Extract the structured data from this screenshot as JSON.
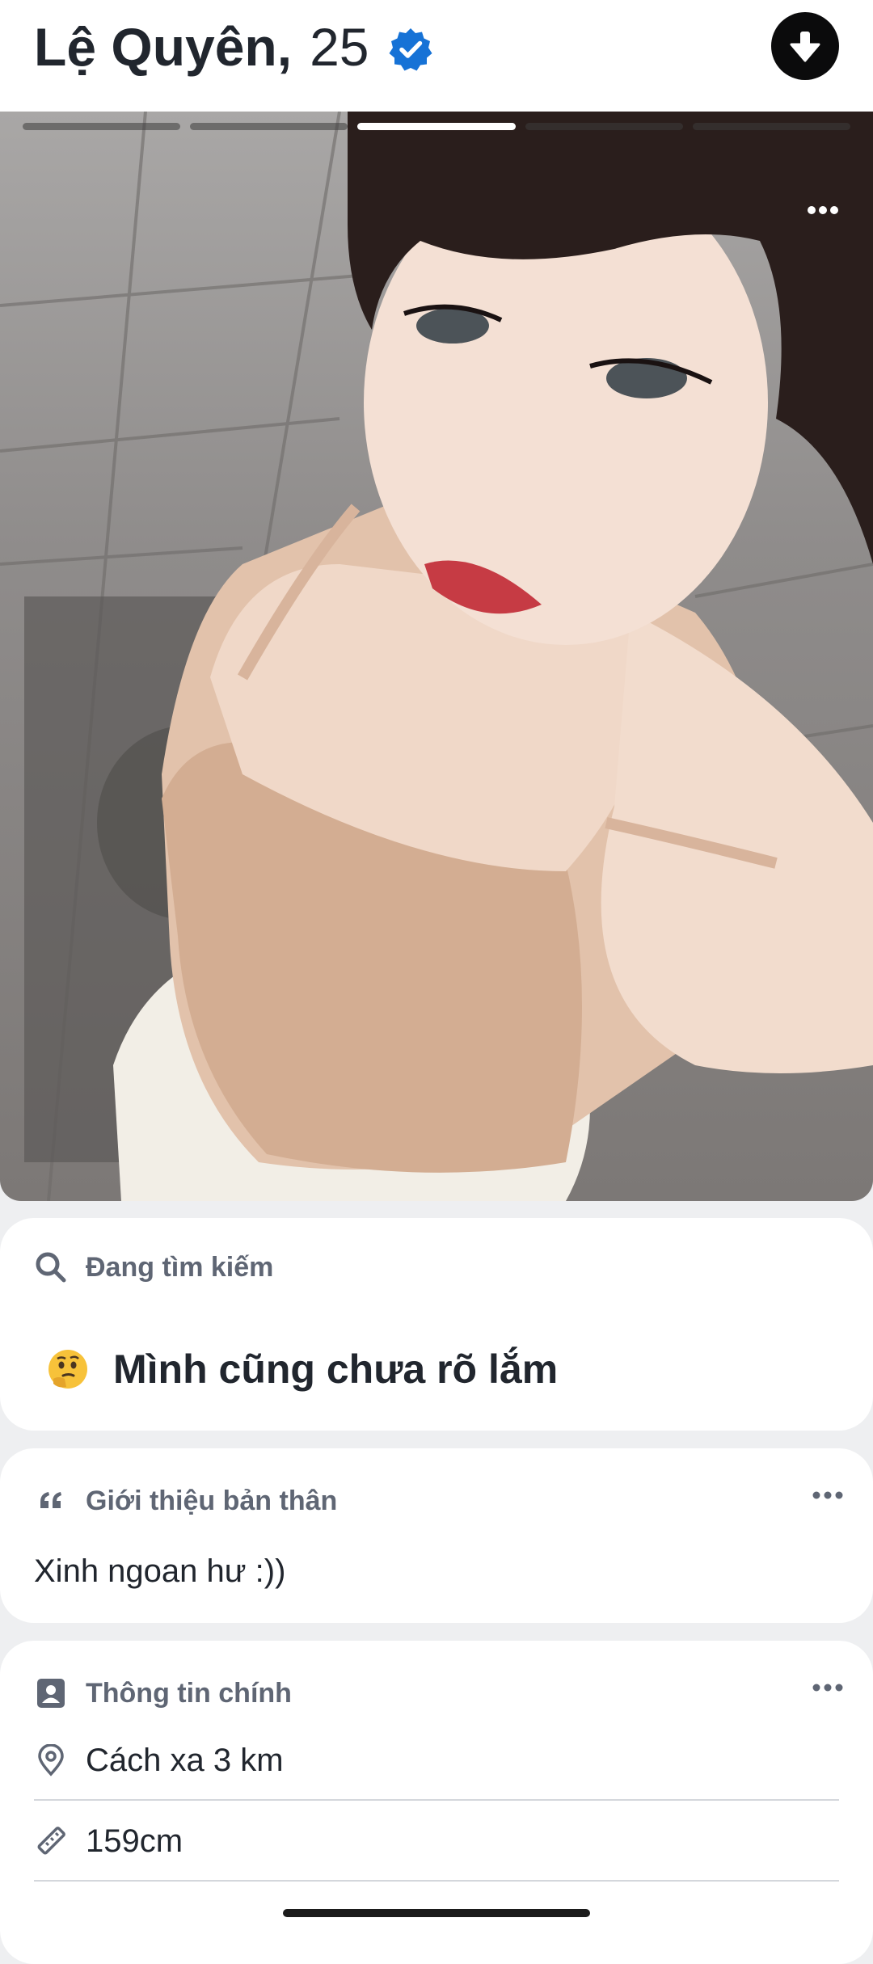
{
  "profile": {
    "name": "Lệ Quyên,",
    "age": "25",
    "verified": true,
    "verified_icon": "verified-badge-icon",
    "download_icon": "arrow-down-icon"
  },
  "photo": {
    "count": 5,
    "active_index": 3,
    "more_icon": "more-horizontal-icon"
  },
  "looking_for": {
    "title": "Đang tìm kiếm",
    "icon": "search-icon",
    "emoji_icon": "thinking-face-icon",
    "value": "Mình cũng chưa rõ lắm"
  },
  "bio": {
    "title": "Giới thiệu bản thân",
    "icon": "quote-icon",
    "text": "Xinh ngoan hư :))"
  },
  "main_info": {
    "title": "Thông tin chính",
    "icon": "contact-card-icon",
    "rows": [
      {
        "icon": "location-pin-icon",
        "text": "Cách xa 3 km"
      },
      {
        "icon": "ruler-icon",
        "text": "159cm"
      }
    ]
  },
  "colors": {
    "verified_blue": "#1672d6",
    "progress_active": "#ffffff",
    "background": "#eeeff1",
    "card": "#ffffff",
    "muted_text": "#5f6674"
  }
}
